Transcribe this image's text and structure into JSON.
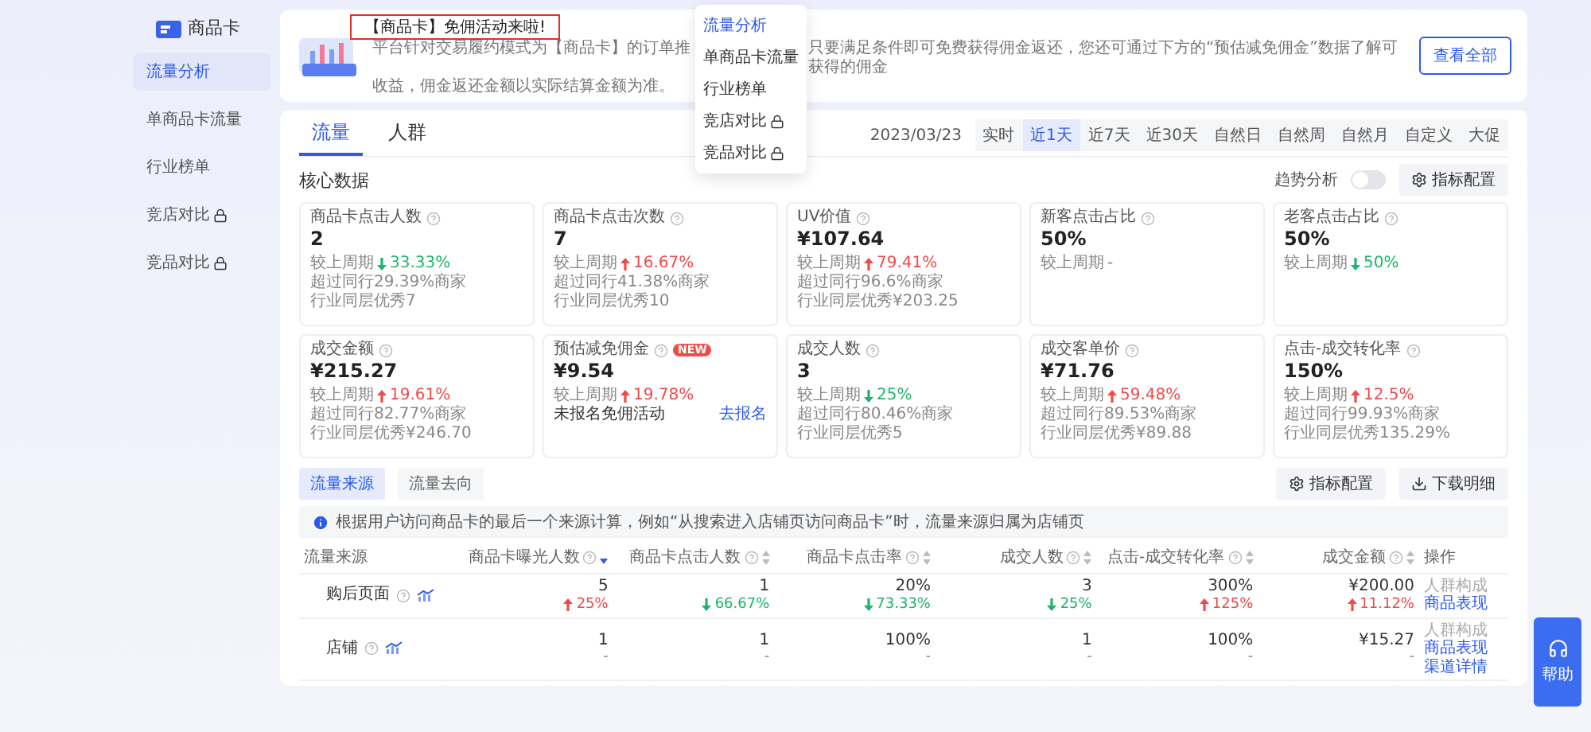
{
  "sidebar": {
    "logo": "商品卡",
    "items": [
      {
        "label": "流量分析",
        "selected": true,
        "locked": false
      },
      {
        "label": "单商品卡流量",
        "selected": false,
        "locked": false
      },
      {
        "label": "行业榜单",
        "selected": false,
        "locked": false
      },
      {
        "label": "竞店对比",
        "selected": false,
        "locked": true
      },
      {
        "label": "竞品对比",
        "selected": false,
        "locked": true
      }
    ]
  },
  "banner": {
    "title": "【商品卡】免佣活动来啦!",
    "text_before": "平台针对交易履约模式为【商品卡】的订单推",
    "text_after": "只要满足条件即可免费获得佣金返还，您还可通过下方的“预估减免佣金”数据了解可获得的佣金",
    "text_line2": "收益，佣金返还金额以实际结算金额为准。",
    "button": "查看全部"
  },
  "dropdown": {
    "items": [
      {
        "label": "流量分析",
        "selected": true,
        "locked": false
      },
      {
        "label": "单商品卡流量",
        "selected": false,
        "locked": false
      },
      {
        "label": "行业榜单",
        "selected": false,
        "locked": false
      },
      {
        "label": "竞店对比",
        "selected": false,
        "locked": true
      },
      {
        "label": "竞品对比",
        "selected": false,
        "locked": true
      }
    ]
  },
  "tabs": [
    {
      "label": "流量",
      "selected": true
    },
    {
      "label": "人群",
      "selected": false
    }
  ],
  "date": "2023/03/23",
  "periods": [
    {
      "label": "实时",
      "selected": false
    },
    {
      "label": "近1天",
      "selected": true
    },
    {
      "label": "近7天",
      "selected": false
    },
    {
      "label": "近30天",
      "selected": false
    },
    {
      "label": "自然日",
      "selected": false
    },
    {
      "label": "自然周",
      "selected": false
    },
    {
      "label": "自然月",
      "selected": false
    },
    {
      "label": "自定义",
      "selected": false
    },
    {
      "label": "大促",
      "selected": false
    }
  ],
  "core": {
    "title": "核心数据",
    "trend_toggle": {
      "label": "趋势分析",
      "on": false
    },
    "config_button": "指标配置"
  },
  "metrics": [
    {
      "label": "商品卡点击人数",
      "value": "2",
      "compare_label": "较上周期",
      "increase": false,
      "delta": "33.33%",
      "lines": [
        "超过同行29.39%商家",
        "行业同层优秀7"
      ]
    },
    {
      "label": "商品卡点击次数",
      "value": "7",
      "compare_label": "较上周期",
      "increase": true,
      "delta": "16.67%",
      "lines": [
        "超过同行41.38%商家",
        "行业同层优秀10"
      ]
    },
    {
      "label": "UV价值",
      "value": "¥107.64",
      "compare_label": "较上周期",
      "increase": true,
      "delta": "79.41%",
      "lines": [
        "超过同行96.6%商家",
        "行业同层优秀¥203.25"
      ]
    },
    {
      "label": "新客点击占比",
      "value": "50%",
      "compare_label": "较上周期",
      "delta": "-"
    },
    {
      "label": "老客点击占比",
      "value": "50%",
      "compare_label": "较上周期",
      "increase": false,
      "delta": "50%"
    },
    {
      "label": "成交金额",
      "value": "¥215.27",
      "compare_label": "较上周期",
      "increase": true,
      "delta": "19.61%",
      "lines": [
        "超过同行82.77%商家",
        "行业同层优秀¥246.70"
      ]
    },
    {
      "label": "预估减免佣金",
      "badge": "NEW",
      "value": "¥9.54",
      "compare_label": "较上周期",
      "increase": true,
      "delta": "19.78%",
      "signup": {
        "text": "未报名免佣活动",
        "link": "去报名"
      }
    },
    {
      "label": "成交人数",
      "value": "3",
      "compare_label": "较上周期",
      "increase": false,
      "delta": "25%",
      "lines": [
        "超过同行80.46%商家",
        "行业同层优秀5"
      ]
    },
    {
      "label": "成交客单价",
      "value": "¥71.76",
      "compare_label": "较上周期",
      "increase": true,
      "delta": "59.48%",
      "lines": [
        "超过同行89.53%商家",
        "行业同层优秀¥89.88"
      ]
    },
    {
      "label": "点击-成交转化率",
      "value": "150%",
      "compare_label": "较上周期",
      "increase": true,
      "delta": "12.5%",
      "lines": [
        "超过同行99.93%商家",
        "行业同层优秀135.29%"
      ]
    }
  ],
  "flow_tabs": [
    {
      "label": "流量来源",
      "selected": true
    },
    {
      "label": "流量去向",
      "selected": false
    }
  ],
  "table_buttons": [
    {
      "label": "指标配置",
      "kind": "settings"
    },
    {
      "label": "下载明细",
      "kind": "download"
    }
  ],
  "notice": "根据用户访问商品卡的最后一个来源计算，例如“从搜索进入店铺页访问商品卡”时，流量来源归属为店铺页",
  "table": {
    "columns": [
      {
        "label": "流量来源",
        "help": false,
        "sortable": false
      },
      {
        "label": "商品卡曝光人数",
        "help": true,
        "sortable": true,
        "sorted": true
      },
      {
        "label": "商品卡点击人数",
        "help": true,
        "sortable": true,
        "sorted": false
      },
      {
        "label": "商品卡点击率",
        "help": true,
        "sortable": true,
        "sorted": false
      },
      {
        "label": "成交人数",
        "help": true,
        "sortable": true,
        "sorted": false
      },
      {
        "label": "点击-成交转化率",
        "help": true,
        "sortable": true,
        "sorted": false
      },
      {
        "label": "成交金额",
        "help": true,
        "sortable": true,
        "sorted": false
      },
      {
        "label": "操作",
        "help": false,
        "sortable": false
      }
    ],
    "rows": [
      {
        "source": "购后页面",
        "cells": [
          {
            "value": "5",
            "increase": true,
            "delta": "25%"
          },
          {
            "value": "1",
            "increase": false,
            "delta": "66.67%"
          },
          {
            "value": "20%",
            "increase": false,
            "delta": "73.33%"
          },
          {
            "value": "3",
            "increase": false,
            "delta": "25%"
          },
          {
            "value": "300%",
            "increase": true,
            "delta": "125%"
          },
          {
            "value": "¥200.00",
            "increase": true,
            "delta": "11.12%"
          }
        ],
        "actions": [
          {
            "label": "人群构成",
            "disabled": true
          },
          {
            "label": "商品表现",
            "disabled": false
          }
        ]
      },
      {
        "source": "店铺",
        "cells": [
          {
            "value": "1",
            "delta": "-"
          },
          {
            "value": "1",
            "delta": "-"
          },
          {
            "value": "100%",
            "delta": "-"
          },
          {
            "value": "1",
            "delta": "-"
          },
          {
            "value": "100%",
            "delta": "-"
          },
          {
            "value": "¥15.27",
            "delta": "-"
          }
        ],
        "actions": [
          {
            "label": "人群构成",
            "disabled": true
          },
          {
            "label": "商品表现",
            "disabled": false
          },
          {
            "label": "渠道详情",
            "disabled": false
          }
        ]
      }
    ]
  },
  "help_button": "帮助"
}
